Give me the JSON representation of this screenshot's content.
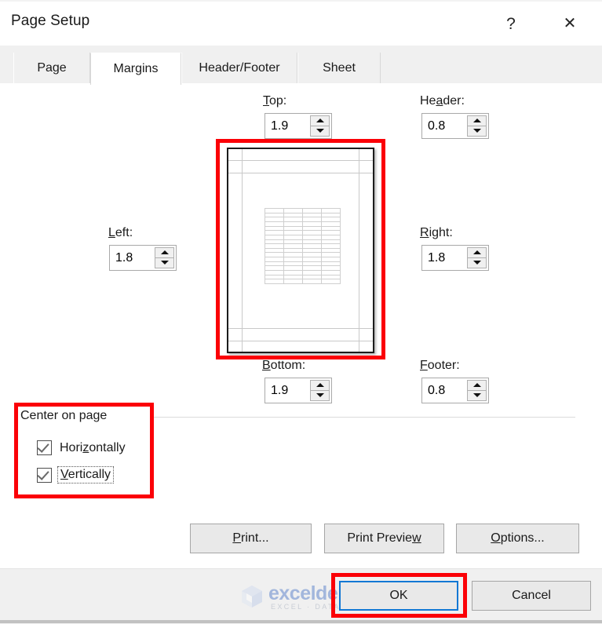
{
  "window": {
    "title": "Page Setup",
    "help_icon": "question-mark-icon",
    "close_icon": "close-x-icon",
    "help_glyph": "?",
    "close_glyph": "✕"
  },
  "tabs": [
    {
      "label": "Page",
      "selected": false
    },
    {
      "label": "Margins",
      "selected": true
    },
    {
      "label": "Header/Footer",
      "selected": false
    },
    {
      "label": "Sheet",
      "selected": false
    }
  ],
  "margins": {
    "top": {
      "label_pre": "T",
      "label_acc": "o",
      "label_post": "p:",
      "value": "1.9"
    },
    "header": {
      "label_pre": "He",
      "label_acc": "a",
      "label_post": "der:",
      "value": "0.8"
    },
    "left": {
      "label_pre": "",
      "label_acc": "L",
      "label_post": "eft:",
      "value": "1.8"
    },
    "right": {
      "label_pre": "",
      "label_acc": "R",
      "label_post": "ight:",
      "value": "1.8"
    },
    "bottom": {
      "label_pre": "",
      "label_acc": "B",
      "label_post": "ottom:",
      "value": "1.9"
    },
    "footer": {
      "label_pre": "",
      "label_acc": "F",
      "label_post": "ooter:",
      "value": "0.8"
    }
  },
  "spinner": {
    "up_icon": "spinner-up-arrow-icon",
    "down_icon": "spinner-down-arrow-icon"
  },
  "preview": {
    "name": "page-margin-preview",
    "table_columns": 4,
    "table_rows": 17
  },
  "center_on_page": {
    "group_label": "Center on page",
    "horizontally": {
      "label_pre": "Hori",
      "label_acc": "z",
      "label_post": "ontally",
      "checked": true,
      "focused": false
    },
    "vertically": {
      "label_pre": "",
      "label_acc": "V",
      "label_post": "ertically",
      "checked": true,
      "focused": true
    }
  },
  "buttons": {
    "print": {
      "label_pre": "",
      "label_acc": "P",
      "label_post": "rint..."
    },
    "print_preview": {
      "label_pre": "Print Previe",
      "label_acc": "w",
      "label_post": ""
    },
    "options": {
      "label_pre": "",
      "label_acc": "O",
      "label_post": "ptions..."
    },
    "ok": {
      "label": "OK"
    },
    "cancel": {
      "label": "Cancel"
    }
  },
  "watermark": {
    "name": "exceldemy",
    "tagline": "EXCEL · DATA · BI",
    "color": "#4472c4"
  },
  "annotations": {
    "accent_color": "#fb0007",
    "focus_color": "#1278d4",
    "items": [
      "preview-highlight",
      "center-on-page-highlight",
      "ok-button-highlight"
    ]
  }
}
